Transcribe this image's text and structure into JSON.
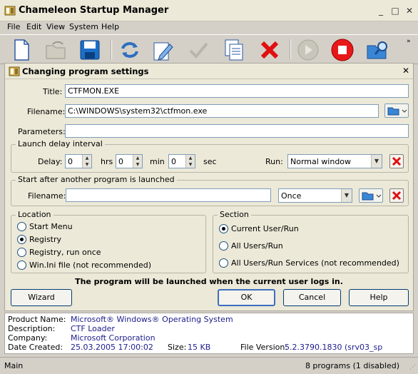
{
  "window": {
    "title": "Chameleon Startup Manager"
  },
  "menu": [
    "File",
    "Edit",
    "View",
    "System",
    "Help"
  ],
  "toolbar": [
    "new-document-icon",
    "open-icon",
    "save-icon",
    "refresh-icon",
    "edit-icon",
    "check-icon",
    "copy-icon",
    "delete-icon",
    "play-icon",
    "stop-icon",
    "search-folder-icon"
  ],
  "dialog": {
    "title": "Changing program settings",
    "title_label": "Title:",
    "title_value": "CTFMON.EXE",
    "filename_label": "Filename:",
    "filename_value": "C:\\WINDOWS\\system32\\ctfmon.exe",
    "parameters_label": "Parameters:",
    "parameters_value": "",
    "delay": {
      "group_label": "Launch delay interval",
      "delay_label": "Delay:",
      "hrs_value": "0",
      "hrs_label": "hrs",
      "min_value": "0",
      "min_label": "min",
      "sec_value": "0",
      "sec_label": "sec",
      "run_label": "Run:",
      "run_value": "Normal window"
    },
    "after": {
      "group_label": "Start after another program is launched",
      "filename_label": "Filename:",
      "filename_value": "",
      "when_value": "Once"
    },
    "location": {
      "group_label": "Location",
      "options": [
        "Start Menu",
        "Registry",
        "Registry, run once",
        "Win.Ini file (not recommended)"
      ],
      "selected": 1
    },
    "section": {
      "group_label": "Section",
      "options": [
        "Current User/Run",
        "All Users/Run",
        "All Users/Run Services (not recommended)"
      ],
      "selected": 0
    },
    "notice": "The program will be launched when the current user logs in.",
    "buttons": {
      "wizard": "Wizard",
      "ok": "OK",
      "cancel": "Cancel",
      "help": "Help"
    }
  },
  "info": {
    "product_name_label": "Product Name:",
    "product_name": "Microsoft® Windows® Operating System",
    "description_label": "Description:",
    "description": "CTF Loader",
    "company_label": "Company:",
    "company": "Microsoft Corporation",
    "date_label": "Date Created:",
    "date": "25.03.2005 17:00:02",
    "size_label": "Size:",
    "size": "15 KB",
    "version_label": "File Version:",
    "version": "5.2.3790.1830 (srv03_sp"
  },
  "status": {
    "left": "Main",
    "right": "8 programs (1 disabled)"
  }
}
